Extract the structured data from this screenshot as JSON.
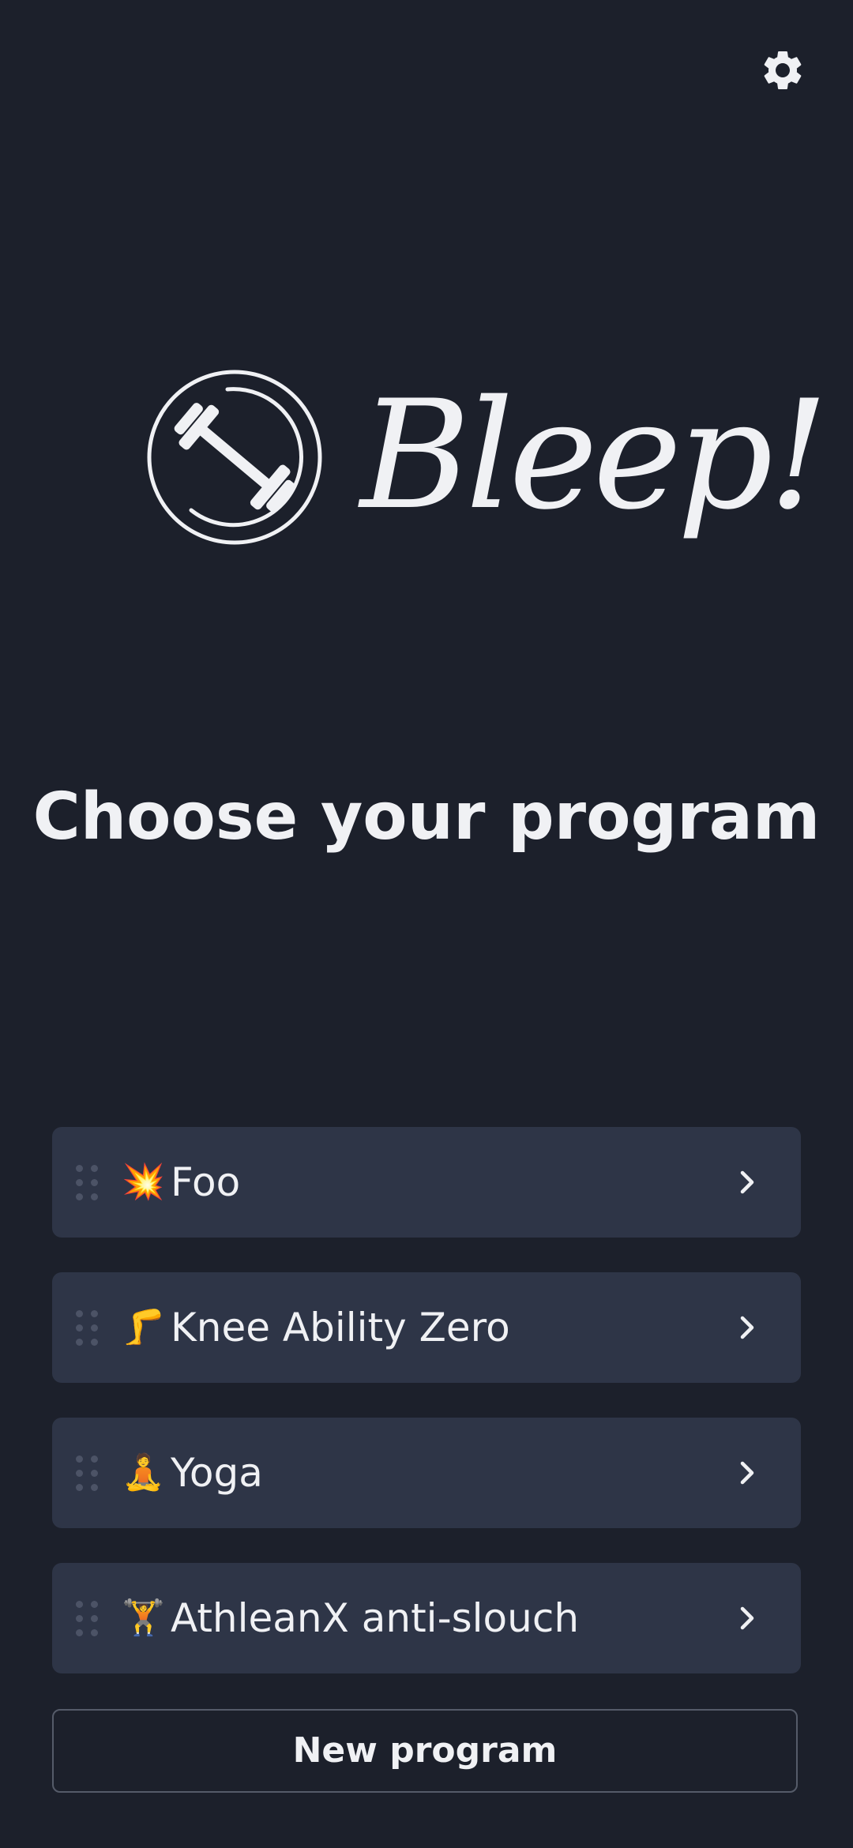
{
  "header": {
    "settings_icon": "gear-icon"
  },
  "logo": {
    "wordmark": "Bleep!",
    "icon": "dumbbell-icon"
  },
  "title": "Choose your program",
  "programs": [
    {
      "emoji": "💥",
      "name": "Foo"
    },
    {
      "emoji": "🦵",
      "name": "Knee Ability Zero"
    },
    {
      "emoji": "🧘",
      "name": "Yoga"
    },
    {
      "emoji": "🏋️",
      "name": "AthleanX anti-slouch"
    }
  ],
  "new_program_label": "New program",
  "colors": {
    "background": "#1c202b",
    "card": "#2e3547",
    "text": "#f0f1f4",
    "border": "#555b69"
  }
}
